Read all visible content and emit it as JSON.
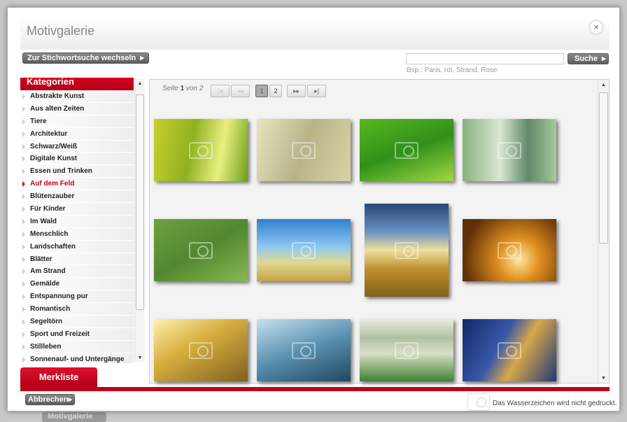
{
  "dialog": {
    "title": "Motivgalerie",
    "close": "×"
  },
  "toolbar": {
    "switch_label": "Zur Stichwortsuche wechseln",
    "search_value": "",
    "search_label": "Suche",
    "search_hint": "Bsp.: Paris, rot, Strand, Rose"
  },
  "sidebar": {
    "header": "Kategorien",
    "active": "Auf dem Feld",
    "items": [
      "Abstrakte Kunst",
      "Aus alten Zeiten",
      "Tiere",
      "Architektur",
      "Schwarz/Weiß",
      "Digitale Kunst",
      "Essen und Trinken",
      "Auf dem Feld",
      "Blütenzauber",
      "Für Kinder",
      "Im Wald",
      "Menschlich",
      "Landschaften",
      "Blätter",
      "Am Strand",
      "Gemälde",
      "Entspannung pur",
      "Romantisch",
      "Segeltörn",
      "Sport und Freizeit",
      "Stillleben",
      "Sonnenauf- und Untergänge"
    ]
  },
  "pagination": {
    "prefix": "Seite",
    "current": "1",
    "sep": "von",
    "total": "2",
    "first": "|◂",
    "prev": "◂◂",
    "pages": [
      "1",
      "2"
    ],
    "next": "▸▸",
    "last": "▸|"
  },
  "images": [
    "Grashalme gelbgrün",
    "Weizenfeld hell",
    "Grünes Gras mit Tautropfen",
    "Grashalme mit Lichtpunkten",
    "Grüne Felder von oben",
    "Ähren vor blauem Himmel",
    "Kornfeld bei Sonnenuntergang",
    "Pflanze vor Sonne",
    "Gräser im Sonnenlicht",
    "Gräser in Blau",
    "Wiese mit Blüten",
    "Weizenähre vor Blau"
  ],
  "merkliste": "Merkliste",
  "footer": {
    "cancel_label": "Abbrechen",
    "watermark_note": "Das Wasserzeichen wird nicht gedruckt.",
    "background_button": "Motivgalerie"
  }
}
